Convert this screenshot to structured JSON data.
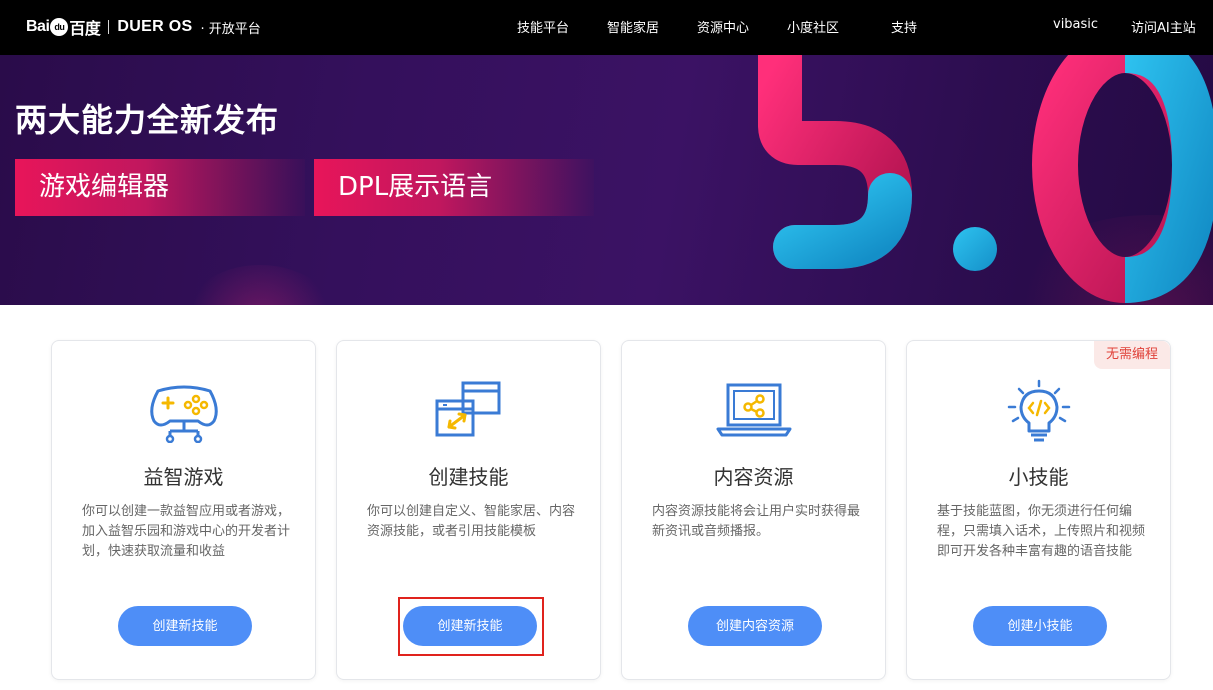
{
  "topbar": {
    "logo": {
      "baidu": "Bai",
      "baidu_paw": "du",
      "baidu_cn": "百度",
      "dueros_text": "DUER",
      "dueros_os": "OS",
      "platform": "· 开放平台"
    },
    "nav": [
      {
        "label": "技能平台"
      },
      {
        "label": "智能家居"
      },
      {
        "label": "资源中心"
      },
      {
        "label": "小度社区"
      },
      {
        "label": "支持"
      }
    ],
    "user": "vibasic",
    "visit_link": "访问AI主站"
  },
  "banner": {
    "headline": "两大能力全新发布",
    "tags": [
      "游戏编辑器",
      "DPL展示语言"
    ],
    "version_art": "5.0"
  },
  "cards": [
    {
      "title": "益智游戏",
      "description": "你可以创建一款益智应用或者游戏，加入益智乐园和游戏中心的开发者计划，快速获取流量和收益",
      "button": "创建新技能",
      "icon": "gamepad-icon"
    },
    {
      "title": "创建技能",
      "description": "你可以创建自定义、智能家居、内容资源技能，或者引用技能模板",
      "button": "创建新技能",
      "icon": "window-transfer-icon",
      "highlighted": true
    },
    {
      "title": "内容资源",
      "description": "内容资源技能将会让用户实时获得最新资讯或音频播报。",
      "button": "创建内容资源",
      "icon": "laptop-share-icon"
    },
    {
      "title": "小技能",
      "description": "基于技能蓝图，你无须进行任何编程，只需填入话术，上传照片和视频即可开发各种丰富有趣的语音技能",
      "button": "创建小技能",
      "icon": "lightbulb-code-icon",
      "badge": "无需编程"
    }
  ],
  "colors": {
    "topbar_bg": "#000000",
    "banner_bg": "#2a0c4a",
    "tag_pink": "#e8155a",
    "button_blue": "#4e8ef7",
    "highlight_red": "#e0231d",
    "icon_blue": "#3a7bd5",
    "icon_yellow": "#f5b800"
  }
}
